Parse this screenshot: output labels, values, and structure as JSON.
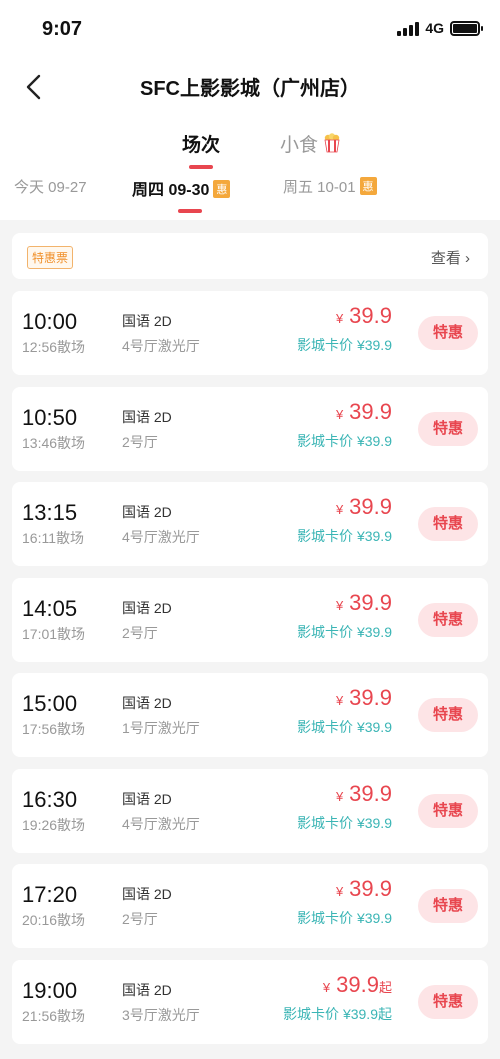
{
  "status": {
    "time": "9:07",
    "network": "4G"
  },
  "nav": {
    "title": "SFC上影影城（广州店）"
  },
  "tabs": {
    "sessions": "场次",
    "snacks": "小食"
  },
  "dates": [
    {
      "label": "今天 09-27"
    },
    {
      "label": "周四 09-30",
      "badge": "惠"
    },
    {
      "label": "周五 10-01",
      "badge": "惠"
    }
  ],
  "promo": {
    "tag": "特惠票",
    "view": "查看 ›"
  },
  "shows": [
    {
      "time": "10:00",
      "end": "12:56散场",
      "lang": "国语 2D",
      "hall": "4号厅激光厅",
      "currency": "¥",
      "price": "39.9",
      "suffix": "",
      "card_price": "影城卡价 ¥39.9",
      "button": "特惠"
    },
    {
      "time": "10:50",
      "end": "13:46散场",
      "lang": "国语 2D",
      "hall": "2号厅",
      "currency": "¥",
      "price": "39.9",
      "suffix": "",
      "card_price": "影城卡价 ¥39.9",
      "button": "特惠"
    },
    {
      "time": "13:15",
      "end": "16:11散场",
      "lang": "国语 2D",
      "hall": "4号厅激光厅",
      "currency": "¥",
      "price": "39.9",
      "suffix": "",
      "card_price": "影城卡价 ¥39.9",
      "button": "特惠"
    },
    {
      "time": "14:05",
      "end": "17:01散场",
      "lang": "国语 2D",
      "hall": "2号厅",
      "currency": "¥",
      "price": "39.9",
      "suffix": "",
      "card_price": "影城卡价 ¥39.9",
      "button": "特惠"
    },
    {
      "time": "15:00",
      "end": "17:56散场",
      "lang": "国语 2D",
      "hall": "1号厅激光厅",
      "currency": "¥",
      "price": "39.9",
      "suffix": "",
      "card_price": "影城卡价 ¥39.9",
      "button": "特惠"
    },
    {
      "time": "16:30",
      "end": "19:26散场",
      "lang": "国语 2D",
      "hall": "4号厅激光厅",
      "currency": "¥",
      "price": "39.9",
      "suffix": "",
      "card_price": "影城卡价 ¥39.9",
      "button": "特惠"
    },
    {
      "time": "17:20",
      "end": "20:16散场",
      "lang": "国语 2D",
      "hall": "2号厅",
      "currency": "¥",
      "price": "39.9",
      "suffix": "",
      "card_price": "影城卡价 ¥39.9",
      "button": "特惠"
    },
    {
      "time": "19:00",
      "end": "21:56散场",
      "lang": "国语 2D",
      "hall": "3号厅激光厅",
      "currency": "¥",
      "price": "39.9",
      "suffix": "起",
      "card_price": "影城卡价 ¥39.9起",
      "button": "特惠"
    }
  ],
  "colors": {
    "accent": "#e8464f",
    "card_price": "#3bb5b5",
    "badge": "#f4a83c"
  }
}
